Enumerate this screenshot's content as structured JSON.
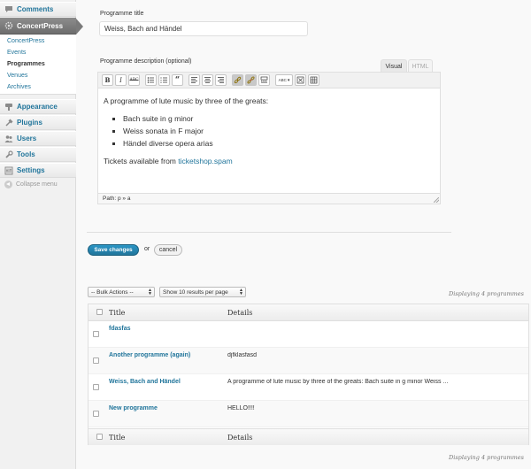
{
  "sidebar": {
    "comments": "Comments",
    "concertpress": "ConcertPress",
    "submenu": [
      "ConcertPress",
      "Events",
      "Programmes",
      "Venues",
      "Archives"
    ],
    "current_submenu": "Programmes",
    "appearance": "Appearance",
    "plugins": "Plugins",
    "users": "Users",
    "tools": "Tools",
    "settings": "Settings",
    "collapse": "Collapse menu"
  },
  "form": {
    "title_label": "Programme title",
    "title_value": "Weiss, Bach and Händel",
    "description_label": "Programme description (optional)",
    "tab_visual": "Visual",
    "tab_html": "HTML",
    "toolbar": {
      "bold": "B",
      "italic": "I",
      "strike": "ABC",
      "spellcheck": "ABC"
    },
    "content": {
      "intro": "A programme of lute music by three of the greats:",
      "items": [
        "Bach suite in g minor",
        "Weiss sonata in F major",
        "Händel diverse opera arias"
      ],
      "tickets_text": "Tickets available from ",
      "tickets_link": "ticketshop.spam"
    },
    "path": "Path: p » a",
    "save": "Save changes",
    "or": "or",
    "cancel": "cancel"
  },
  "list": {
    "bulk_actions": "-- Bulk Actions --",
    "per_page": "Show 10 results per page",
    "displaying": "Displaying 4 programmes",
    "col_title": "Title",
    "col_details": "Details",
    "rows": [
      {
        "title": "fdasfas",
        "details": ""
      },
      {
        "title": "Another programme (again)",
        "details": "djfklasfasd"
      },
      {
        "title": "Weiss, Bach and Händel",
        "details": "A programme of lute music by three of the greats: Bach suite in g minor Weiss ..."
      },
      {
        "title": "New programme",
        "details": "HELLO!!!!"
      }
    ]
  },
  "colors": {
    "link": "#21759b",
    "active_menu": "#777777",
    "primary_button": "#21759b"
  },
  "icons": {
    "comments": "speech-bubble-icon",
    "concertpress": "gear-icon",
    "appearance": "paintbrush-icon",
    "plugins": "plug-icon",
    "users": "users-icon",
    "tools": "wrench-icon",
    "settings": "settings-icon"
  }
}
